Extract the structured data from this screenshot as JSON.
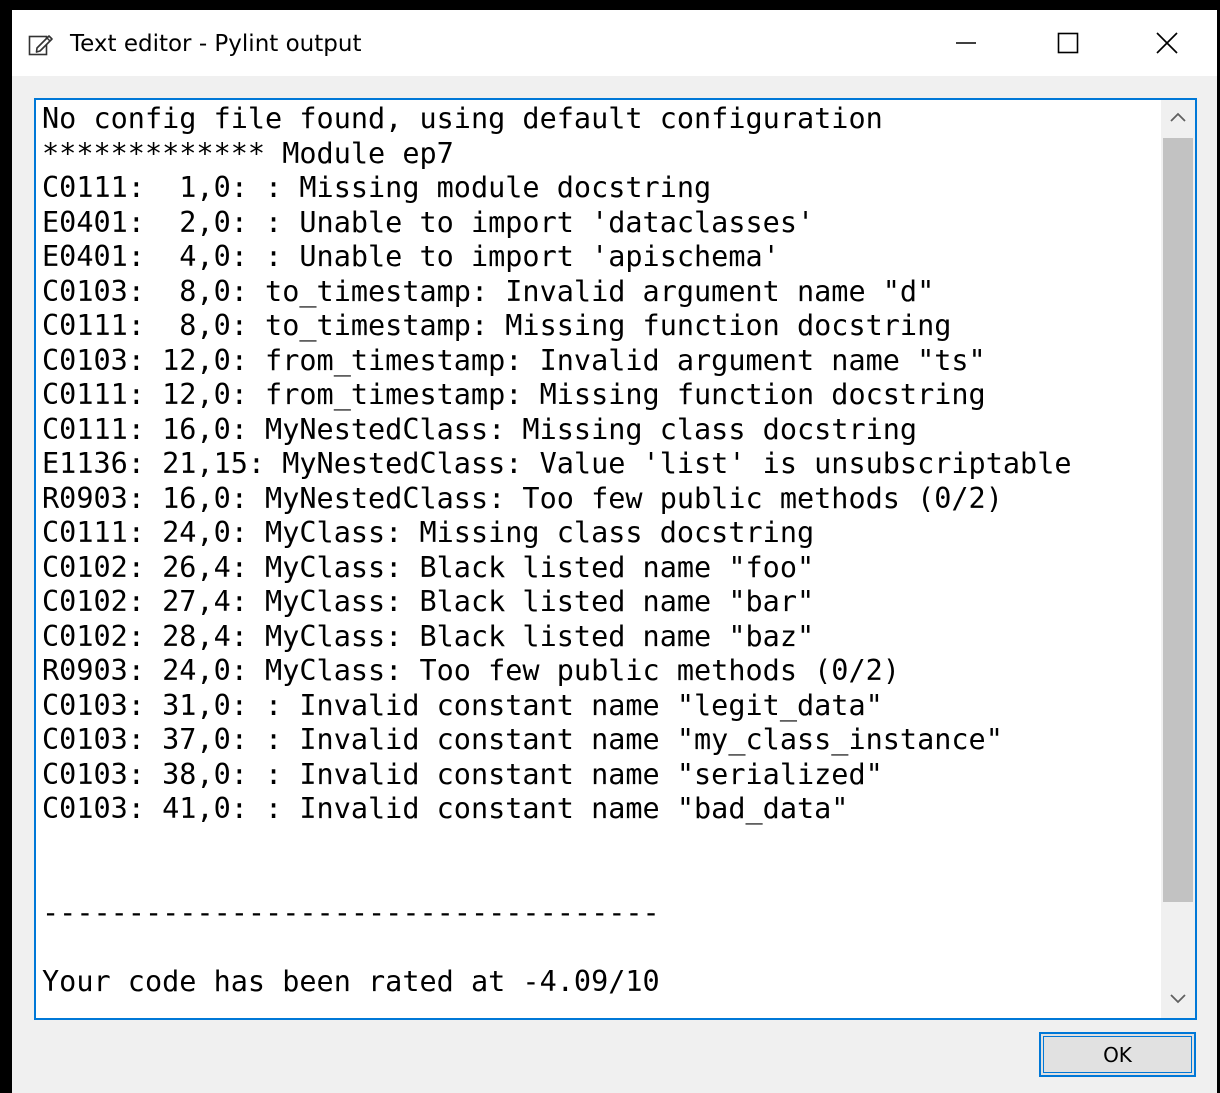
{
  "window": {
    "title": "Text editor - Pylint output",
    "title_icon": "edit-note-icon",
    "controls": {
      "minimize_icon": "minimize-icon",
      "maximize_icon": "maximize-icon",
      "close_icon": "close-icon"
    }
  },
  "output": {
    "lines": [
      "No config file found, using default configuration",
      "************* Module ep7",
      "C0111:  1,0: : Missing module docstring",
      "E0401:  2,0: : Unable to import 'dataclasses'",
      "E0401:  4,0: : Unable to import 'apischema'",
      "C0103:  8,0: to_timestamp: Invalid argument name \"d\"",
      "C0111:  8,0: to_timestamp: Missing function docstring",
      "C0103: 12,0: from_timestamp: Invalid argument name \"ts\"",
      "C0111: 12,0: from_timestamp: Missing function docstring",
      "C0111: 16,0: MyNestedClass: Missing class docstring",
      "E1136: 21,15: MyNestedClass: Value 'list' is unsubscriptable",
      "R0903: 16,0: MyNestedClass: Too few public methods (0/2)",
      "C0111: 24,0: MyClass: Missing class docstring",
      "C0102: 26,4: MyClass: Black listed name \"foo\"",
      "C0102: 27,4: MyClass: Black listed name \"bar\"",
      "C0102: 28,4: MyClass: Black listed name \"baz\"",
      "R0903: 24,0: MyClass: Too few public methods (0/2)",
      "C0103: 31,0: : Invalid constant name \"legit_data\"",
      "C0103: 37,0: : Invalid constant name \"my_class_instance\"",
      "C0103: 38,0: : Invalid constant name \"serialized\"",
      "C0103: 41,0: : Invalid constant name \"bad_data\"",
      "",
      "",
      "------------------------------------",
      "",
      "Your code has been rated at -4.09/10"
    ]
  },
  "scrollbar": {
    "up_icon": "chevron-up-icon",
    "down_icon": "chevron-down-icon"
  },
  "buttons": {
    "ok_label": "OK"
  },
  "colors": {
    "accent": "#0078d7",
    "dialog_background": "#f0f0f0",
    "scroll_thumb": "#c2c2c2"
  }
}
